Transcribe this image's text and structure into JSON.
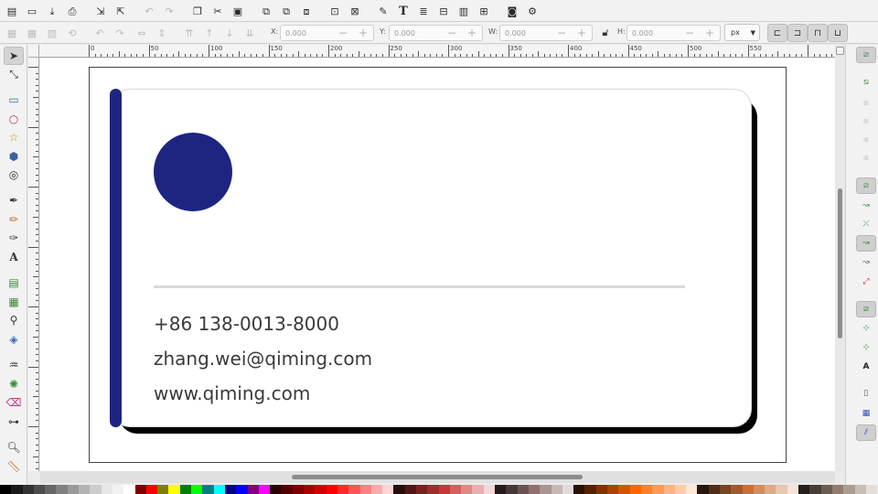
{
  "toolbar": {
    "x_label": "X:",
    "x_value": "0.000",
    "y_label": "Y:",
    "y_value": "0.000",
    "w_label": "W:",
    "w_value": "0.000",
    "h_label": "H:",
    "h_value": "0.000",
    "unit": "px",
    "minus": "−",
    "plus": "+"
  },
  "ruler": {
    "top_labels": [
      "0",
      "50",
      "100",
      "150",
      "200",
      "250",
      "300",
      "350",
      "400",
      "450",
      "500",
      "550"
    ]
  },
  "card": {
    "phone": "+86 138-0013-8000",
    "email": "zhang.wei@qiming.com",
    "website": "www.qiming.com"
  },
  "colors": {
    "accent": "#1e2580",
    "divider": "#d9d9d9",
    "text": "#3a3a3a"
  },
  "palette": [
    "#000000",
    "#1a1a1a",
    "#333333",
    "#4d4d4d",
    "#666666",
    "#808080",
    "#999999",
    "#b3b3b3",
    "#cccccc",
    "#e6e6e6",
    "#f2f2f2",
    "#ffffff",
    "#800000",
    "#ff0000",
    "#808000",
    "#ffff00",
    "#008000",
    "#00ff00",
    "#008080",
    "#00ffff",
    "#000080",
    "#0000ff",
    "#800080",
    "#ff00ff",
    "#2b0000",
    "#550000",
    "#800000",
    "#aa0000",
    "#d40000",
    "#ff0000",
    "#ff2a2a",
    "#ff5555",
    "#ff8080",
    "#ffaaaa",
    "#ffd5d5",
    "#280b0b",
    "#501616",
    "#782121",
    "#a02c2c",
    "#c83737",
    "#d35f5f",
    "#de8787",
    "#e9afaf",
    "#f4d7d7",
    "#241c1c",
    "#483737",
    "#6c5353",
    "#916f6f",
    "#ac9393",
    "#c8b7b7",
    "#e3dbdb",
    "#2b1100",
    "#552200",
    "#803300",
    "#aa4400",
    "#d45500",
    "#ff6600",
    "#ff7f2a",
    "#ff9955",
    "#ffb380",
    "#ffccaa",
    "#ffe6d5",
    "#28170b",
    "#502d16",
    "#784421",
    "#a05a2c",
    "#c87137",
    "#d38d5f",
    "#deaa87",
    "#e9c6af",
    "#f4e3d7",
    "#241f1c",
    "#483e37",
    "#6c5d53",
    "#917c6f",
    "#ac9d93",
    "#c8beb7",
    "#e3dedb"
  ]
}
